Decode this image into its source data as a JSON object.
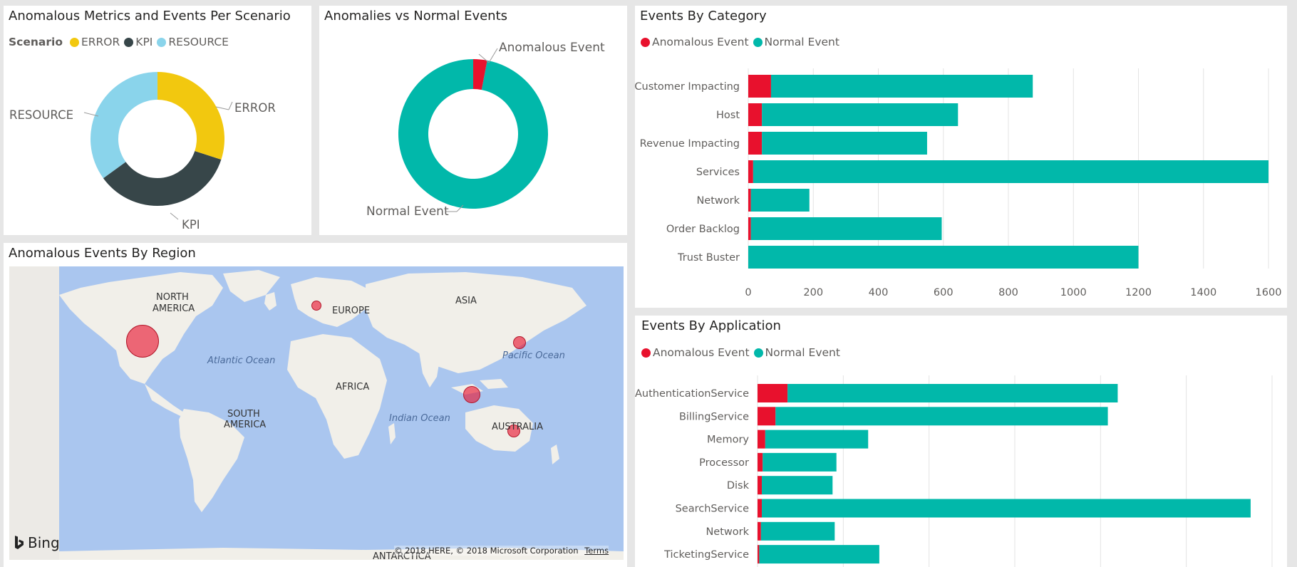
{
  "colors": {
    "anomalous": "#e8112d",
    "normal": "#01b8aa",
    "error": "#f2c80f",
    "kpi": "#374649",
    "resource": "#8ad4eb",
    "water": "#aac6ef",
    "land": "#f1efe9"
  },
  "scenario_panel": {
    "title": "Anomalous Metrics and Events Per Scenario",
    "legend_title": "Scenario",
    "legend": [
      "ERROR",
      "KPI",
      "RESOURCE"
    ]
  },
  "anomalies_panel": {
    "title": "Anomalies vs Normal Events",
    "labels": [
      "Anomalous Event",
      "Normal Event"
    ]
  },
  "category_panel": {
    "title": "Events By Category",
    "legend": [
      "Anomalous Event",
      "Normal Event"
    ]
  },
  "application_panel": {
    "title": "Events By Application",
    "legend": [
      "Anomalous Event",
      "Normal Event"
    ]
  },
  "map_panel": {
    "title": "Anomalous Events By Region",
    "region_labels": {
      "north_america_1": "NORTH",
      "north_america_2": "AMERICA",
      "europe": "EUROPE",
      "asia": "ASIA",
      "africa": "AFRICA",
      "south_america_1": "SOUTH",
      "south_america_2": "AMERICA",
      "australia": "AUSTRALIA",
      "antarctica": "ANTARCTICA"
    },
    "ocean_labels": {
      "atlantic": "Atlantic Ocean",
      "pacific": "Pacific Ocean",
      "indian": "Indian Ocean"
    },
    "bing_logo": "Bing",
    "copyright": "© 2018 HERE, © 2018 Microsoft Corporation",
    "terms_link": "Terms"
  },
  "chart_data": [
    {
      "type": "pie",
      "chart_id": "scenario",
      "categories": [
        "ERROR",
        "KPI",
        "RESOURCE"
      ],
      "values": [
        30,
        35,
        35
      ]
    },
    {
      "type": "pie",
      "chart_id": "anomalies",
      "categories": [
        "Anomalous Event",
        "Normal Event"
      ],
      "values": [
        3,
        97
      ]
    },
    {
      "type": "bar",
      "chart_id": "category",
      "orientation": "horizontal",
      "stacked": true,
      "categories": [
        "Customer Impacting",
        "Host",
        "Revenue Impacting",
        "Services",
        "Network",
        "Order Backlog",
        "Trust Buster"
      ],
      "series": [
        {
          "name": "Anomalous Event",
          "values": [
            70,
            42,
            42,
            15,
            8,
            8,
            0
          ]
        },
        {
          "name": "Normal Event",
          "values": [
            805,
            603,
            508,
            1585,
            180,
            587,
            1200
          ]
        }
      ],
      "xlim": [
        0,
        1600
      ],
      "xticks": [
        0,
        200,
        400,
        600,
        800,
        1000,
        1200,
        1400,
        1600
      ],
      "grid": true,
      "legend_position": "top-left"
    },
    {
      "type": "bar",
      "chart_id": "application",
      "orientation": "horizontal",
      "stacked": true,
      "categories": [
        "AuthenticationService",
        "BillingService",
        "Memory",
        "Processor",
        "Disk",
        "SearchService",
        "Network",
        "TicketingService"
      ],
      "series": [
        {
          "name": "Anomalous Event",
          "values": [
            70,
            42,
            18,
            12,
            10,
            10,
            8,
            4
          ]
        },
        {
          "name": "Normal Event",
          "values": [
            770,
            775,
            240,
            172,
            165,
            1140,
            172,
            280
          ]
        }
      ],
      "xlim": [
        0,
        1200
      ],
      "grid": true,
      "legend_position": "top-left"
    },
    {
      "type": "scatter",
      "chart_id": "region_bubbles",
      "points": [
        {
          "region": "North America (US West)",
          "lat": 35,
          "lon": -118,
          "size": 10
        },
        {
          "region": "Europe (UK)",
          "lat": 54,
          "lon": -6,
          "size": 1
        },
        {
          "region": "Asia (Japan)",
          "lat": 35,
          "lon": 139,
          "size": 2
        },
        {
          "region": "Southeast Asia (Indonesia)",
          "lat": -6,
          "lon": 107,
          "size": 3
        },
        {
          "region": "Australia",
          "lat": -25,
          "lon": 133,
          "size": 2
        }
      ]
    }
  ]
}
